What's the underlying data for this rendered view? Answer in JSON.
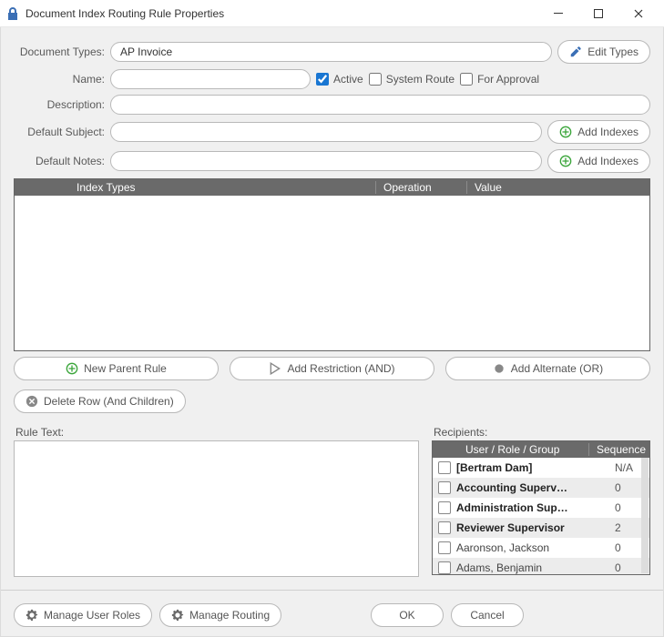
{
  "window": {
    "title": "Document Index Routing Rule Properties"
  },
  "form": {
    "document_types_label": "Document Types:",
    "document_types_value": "AP Invoice",
    "edit_types": "Edit Types",
    "name_label": "Name:",
    "name_value": "",
    "active_label": "Active",
    "active_checked": true,
    "system_route_label": "System Route",
    "system_route_checked": false,
    "for_approval_label": "For Approval",
    "for_approval_checked": false,
    "description_label": "Description:",
    "description_value": "",
    "default_subject_label": "Default Subject:",
    "default_subject_value": "",
    "default_notes_label": "Default Notes:",
    "default_notes_value": "",
    "add_indexes": "Add Indexes"
  },
  "index_grid": {
    "col_index_types": "Index Types",
    "col_operation": "Operation",
    "col_value": "Value"
  },
  "rule_buttons": {
    "new_parent": "New Parent Rule",
    "add_restriction": "Add Restriction (AND)",
    "add_alternate": "Add Alternate (OR)",
    "delete_row": "Delete Row (And Children)"
  },
  "rule_text_label": "Rule Text:",
  "recipients": {
    "label": "Recipients:",
    "col_user": "User / Role / Group",
    "col_seq": "Sequence",
    "rows": [
      {
        "name": "[Bertram Dam]",
        "seq": "N/A",
        "bold": true
      },
      {
        "name": "Accounting Superv…",
        "seq": "0",
        "bold": true
      },
      {
        "name": "Administration Sup…",
        "seq": "0",
        "bold": true
      },
      {
        "name": "Reviewer Supervisor",
        "seq": "2",
        "bold": true
      },
      {
        "name": "Aaronson, Jackson",
        "seq": "0",
        "bold": false
      },
      {
        "name": "Adams, Benjamin",
        "seq": "0",
        "bold": false
      }
    ]
  },
  "footer": {
    "manage_user_roles": "Manage User Roles",
    "manage_routing": "Manage Routing",
    "ok": "OK",
    "cancel": "Cancel"
  }
}
